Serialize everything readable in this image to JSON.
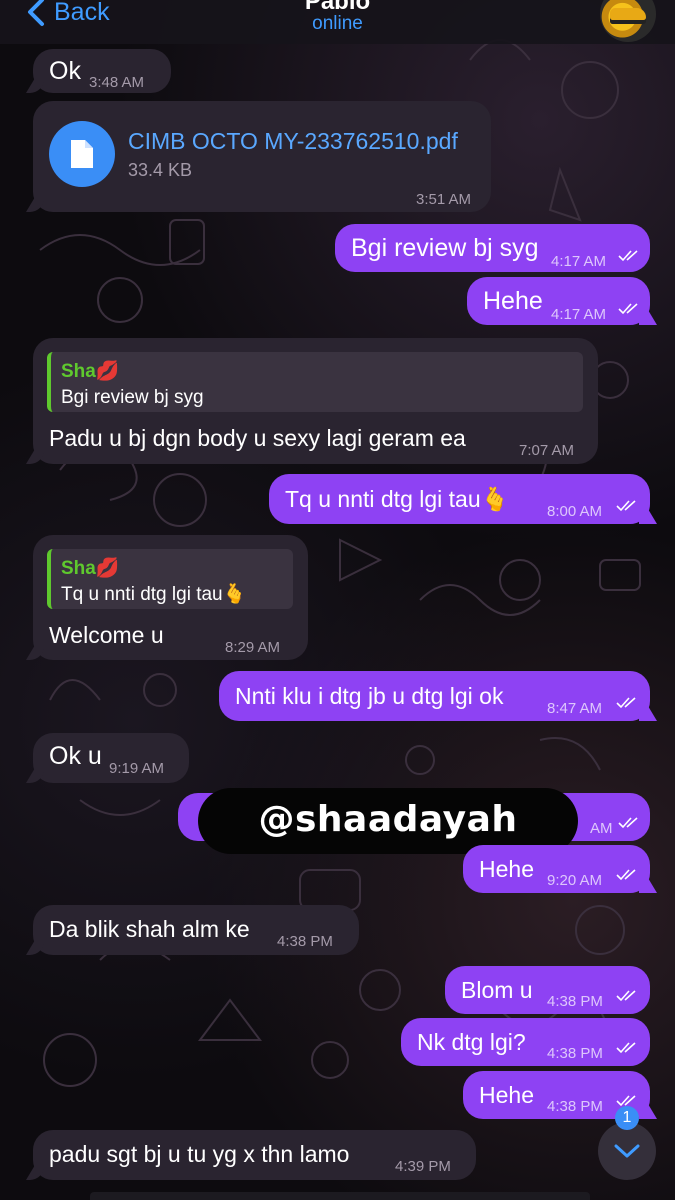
{
  "header": {
    "back_label": "Back",
    "contact_name": "Pablo",
    "status": "online"
  },
  "messages": [
    {
      "dir": "in",
      "text": "Ok",
      "time": "3:48 AM"
    },
    {
      "dir": "in",
      "type": "file",
      "file_name": "CIMB OCTO MY-233762510.pdf",
      "file_size": "33.4 KB",
      "time": "3:51 AM"
    },
    {
      "dir": "out",
      "text": "Bgi review bj syg",
      "time": "4:17 AM"
    },
    {
      "dir": "out",
      "text": "Hehe",
      "time": "4:17 AM"
    },
    {
      "dir": "in",
      "reply_name": "Sha💋",
      "reply_text": "Bgi review bj syg",
      "text": "Padu u bj dgn body u sexy lagi geram ea",
      "time": "7:07 AM"
    },
    {
      "dir": "out",
      "text": "Tq u nnti dtg lgi tau🫰",
      "time": "8:00 AM"
    },
    {
      "dir": "in",
      "reply_name": "Sha💋",
      "reply_text": "Tq u nnti dtg lgi tau🫰",
      "text": "Welcome u",
      "time": "8:29 AM"
    },
    {
      "dir": "out",
      "text": "Nnti klu i dtg jb u dtg lgi ok",
      "time": "8:47 AM"
    },
    {
      "dir": "in",
      "text": "Ok u",
      "time": "9:19 AM"
    },
    {
      "dir": "out",
      "text": "",
      "time": "AM"
    },
    {
      "dir": "out",
      "text": "Hehe",
      "time": "9:20 AM"
    },
    {
      "dir": "in",
      "text": "Da blik shah alm ke",
      "time": "4:38 PM"
    },
    {
      "dir": "out",
      "text": "Blom u",
      "time": "4:38 PM"
    },
    {
      "dir": "out",
      "text": "Nk dtg lgi?",
      "time": "4:38 PM"
    },
    {
      "dir": "out",
      "text": "Hehe",
      "time": "4:38 PM"
    },
    {
      "dir": "in",
      "text": "padu sgt bj u tu yg x thn lamo",
      "time": "4:39 PM"
    }
  ],
  "watermark": "@shaadayah",
  "unread_count": "1",
  "colors": {
    "accent": "#3f9bff",
    "outgoing_bubble": "#8e42f3",
    "incoming_bubble": "#2a2430",
    "reply_accent": "#5fc92e"
  },
  "icons": [
    "chevron-left-icon",
    "document-icon",
    "double-check-icon",
    "chevron-down-icon"
  ]
}
